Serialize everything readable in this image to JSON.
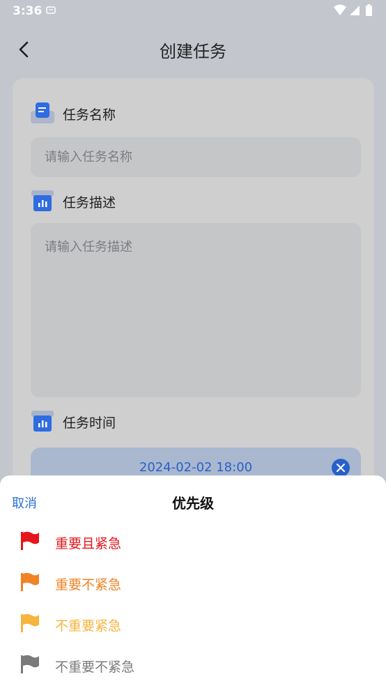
{
  "status_bar": {
    "time": "3:36"
  },
  "app_bar": {
    "title": "创建任务"
  },
  "form": {
    "name_label": "任务名称",
    "name_placeholder": "请输入任务名称",
    "desc_label": "任务描述",
    "desc_placeholder": "请输入任务描述",
    "time_label": "任务时间",
    "time_value": "2024-02-02 18:00"
  },
  "sheet": {
    "cancel_label": "取消",
    "title": "优先级",
    "options": [
      {
        "label": "重要且紧急",
        "color": "#e8141b"
      },
      {
        "label": "重要不紧急",
        "color": "#f08324"
      },
      {
        "label": "不重要紧急",
        "color": "#f7b43e"
      },
      {
        "label": "不重要不紧急",
        "color": "#7a7a7a"
      }
    ]
  },
  "colors": {
    "accent": "#2a6fd1",
    "icon_blue": "#2f6ce0"
  }
}
